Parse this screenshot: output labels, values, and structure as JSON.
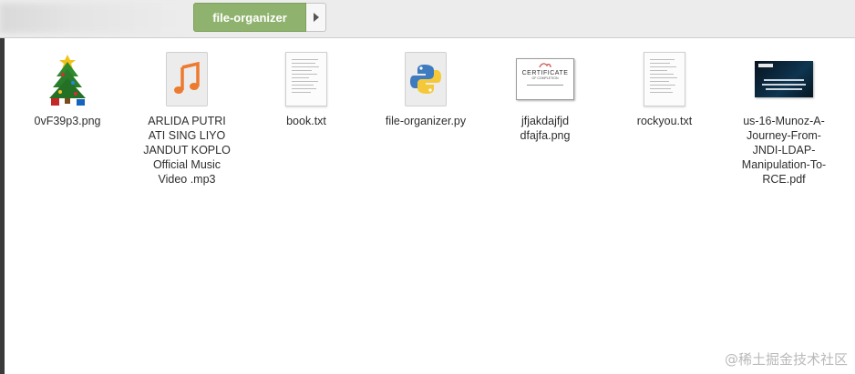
{
  "pathbar": {
    "current_folder": "file-organizer",
    "next_arrow_icon": "chevron-right-icon"
  },
  "files": [
    {
      "name": "0vF39p3.png",
      "icon": "christmas-tree-thumbnail"
    },
    {
      "name": "ARLIDA PUTRI ATI SING LIYO JANDUT KOPLO Official Music Video .mp3",
      "icon": "music-note-icon"
    },
    {
      "name": "book.txt",
      "icon": "text-document-icon"
    },
    {
      "name": "file-organizer.py",
      "icon": "python-icon"
    },
    {
      "name": "jfjakdajfjd  dfajfa.png",
      "icon": "certificate-thumbnail"
    },
    {
      "name": "rockyou.txt",
      "icon": "text-document-icon"
    },
    {
      "name": "us-16-Munoz-A-Journey-From-JNDI-LDAP-Manipulation-To-RCE.pdf",
      "icon": "pdf-thumbnail"
    }
  ],
  "certificate_thumb": {
    "title": "CERTIFICATE",
    "subtitle": "OF COMPLETION"
  },
  "watermark": "@稀土掘金技术社区",
  "colors": {
    "accent": "#8fb36e",
    "background": "#ffffff",
    "pathbar": "#ececec"
  }
}
